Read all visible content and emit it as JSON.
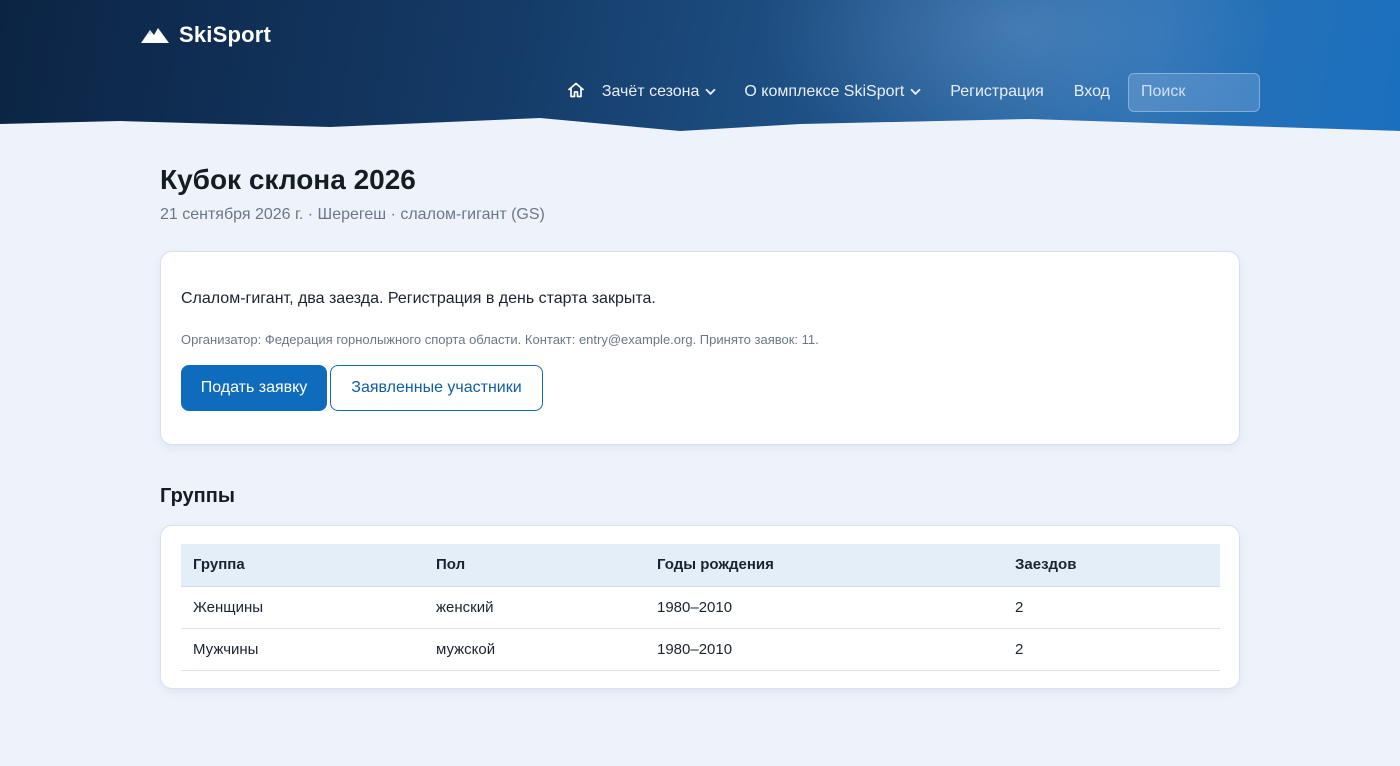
{
  "brand": {
    "name": "SkiSport",
    "logo_icon": "mountain-icon"
  },
  "nav": {
    "home_icon": "home-icon",
    "items": [
      {
        "label": "Зачёт сезона",
        "has_dropdown": true
      },
      {
        "label": "О комплексе SkiSport",
        "has_dropdown": true
      },
      {
        "label": "Регистрация",
        "has_dropdown": false
      },
      {
        "label": "Вход",
        "has_dropdown": false
      }
    ],
    "search_placeholder": "Поиск"
  },
  "event": {
    "title": "Кубок склона 2026",
    "subtitle": "21 сентября 2026 г. · Шерегеш · слалом-гигант (GS)",
    "description": "Слалом-гигант, два заезда. Регистрация в день старта закрыта.",
    "note": "Организатор: Федерация горнолыжного спорта области. Контакт: entry@example.org. Принято заявок: 11.",
    "apply_button": "Подать заявку",
    "participants_button": "Заявленные участники"
  },
  "groups": {
    "title": "Группы",
    "columns": [
      "Группа",
      "Пол",
      "Годы рождения",
      "Заездов"
    ],
    "rows": [
      [
        "Женщины",
        "женский",
        "1980–2010",
        "2"
      ],
      [
        "Мужчины",
        "мужской",
        "1980–2010",
        "2"
      ]
    ]
  },
  "colors": {
    "accent": "#0f6cbd",
    "header_dark": "#0c2444",
    "page_bg": "#eef3fb"
  }
}
